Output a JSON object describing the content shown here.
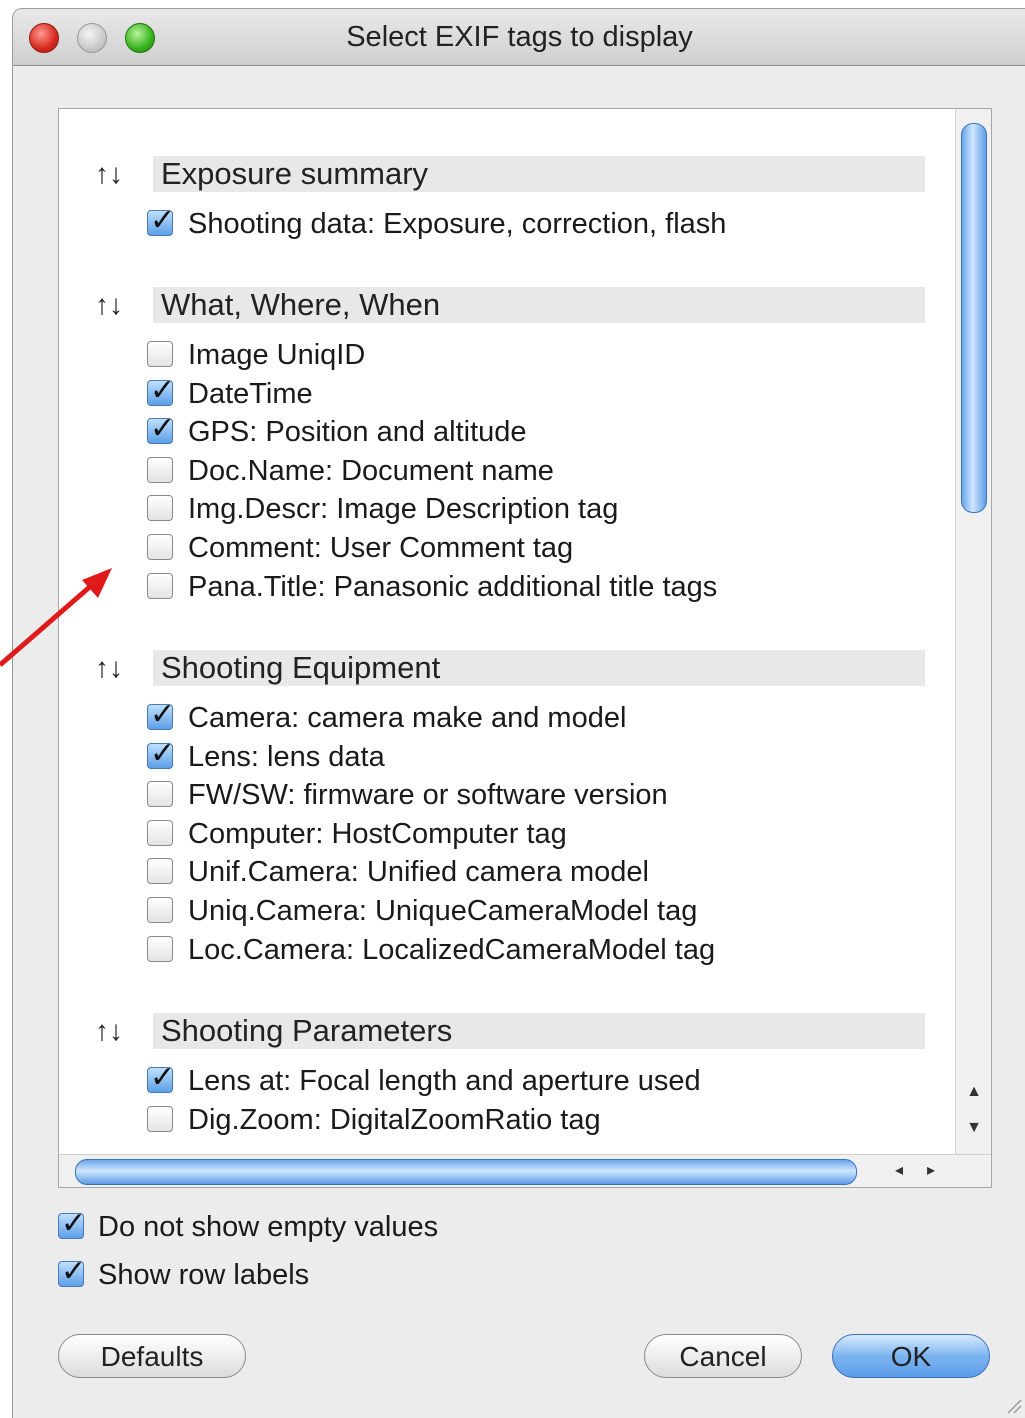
{
  "window": {
    "title": "Select EXIF tags to display"
  },
  "sections": [
    {
      "title": "Exposure summary",
      "arrows": "↑↓",
      "items": [
        {
          "label": "Shooting data: Exposure, correction, flash",
          "checked": true
        }
      ]
    },
    {
      "title": "What, Where, When",
      "arrows": "↑↓",
      "items": [
        {
          "label": "Image UniqID",
          "checked": false
        },
        {
          "label": "DateTime",
          "checked": true
        },
        {
          "label": "GPS: Position and altitude",
          "checked": true
        },
        {
          "label": "Doc.Name: Document name",
          "checked": false
        },
        {
          "label": "Img.Descr: Image Description tag",
          "checked": false
        },
        {
          "label": "Comment: User Comment tag",
          "checked": false
        },
        {
          "label": "Pana.Title: Panasonic additional title tags",
          "checked": false
        }
      ]
    },
    {
      "title": "Shooting Equipment",
      "arrows": "↑↓",
      "items": [
        {
          "label": "Camera: camera make and model",
          "checked": true
        },
        {
          "label": "Lens: lens data",
          "checked": true
        },
        {
          "label": "FW/SW: firmware or software version",
          "checked": false
        },
        {
          "label": "Computer: HostComputer tag",
          "checked": false
        },
        {
          "label": "Unif.Camera: Unified camera model",
          "checked": false
        },
        {
          "label": "Uniq.Camera: UniqueCameraModel tag",
          "checked": false
        },
        {
          "label": "Loc.Camera: LocalizedCameraModel tag",
          "checked": false
        }
      ]
    },
    {
      "title": "Shooting Parameters",
      "arrows": "↑↓",
      "items": [
        {
          "label": "Lens at: Focal length and aperture used",
          "checked": true
        },
        {
          "label": "Dig.Zoom: DigitalZoomRatio tag",
          "checked": false
        }
      ]
    }
  ],
  "options": [
    {
      "label": "Do not show empty values",
      "checked": true
    },
    {
      "label": "Show row labels",
      "checked": true
    }
  ],
  "buttons": {
    "defaults": "Defaults",
    "cancel": "Cancel",
    "ok": "OK"
  },
  "colors": {
    "annotation_arrow": "#e0191b",
    "accent": "#5c9de8"
  }
}
